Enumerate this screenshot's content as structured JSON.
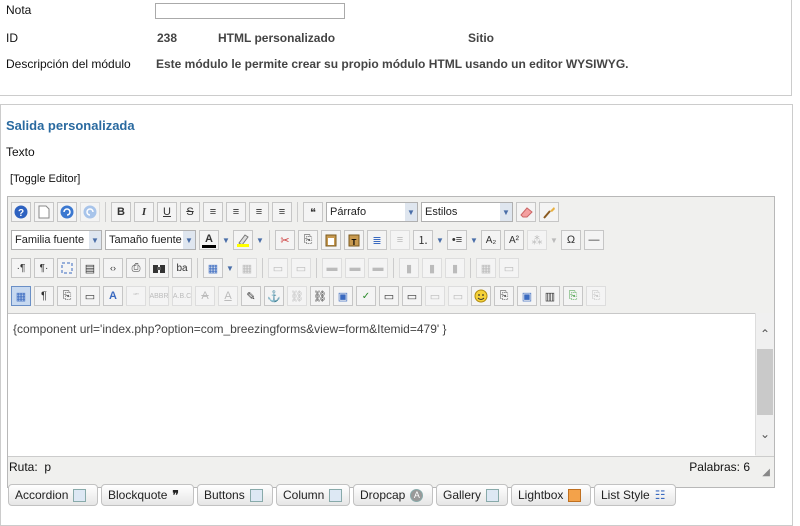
{
  "details": {
    "note_label": "Nota",
    "id_label": "ID",
    "id_value": "238",
    "type_value": "HTML personalizado",
    "site_value": "Sitio",
    "desc_label": "Descripción del módulo",
    "desc_value": "Este módulo le permite crear su propio módulo HTML usando un editor WYSIWYG."
  },
  "output": {
    "legend": "Salida personalizada",
    "text_label": "Texto",
    "toggle_label": "[Toggle Editor]"
  },
  "toolbar": {
    "format_select": "Párrafo",
    "styles_select": "Estilos",
    "font_family_select": "Familia fuente",
    "font_size_select": "Tamaño fuente"
  },
  "editor": {
    "content": "{component url='index.php?option=com_breezingforms&view=form&Itemid=479' }",
    "path_label": "Ruta:",
    "path_value": "p",
    "word_count": "Palabras: 6"
  },
  "plugins": [
    {
      "label": "Accordion",
      "icon": "accordion-icon"
    },
    {
      "label": "Blockquote",
      "icon": "quote-icon"
    },
    {
      "label": "Buttons",
      "icon": "button-icon"
    },
    {
      "label": "Column",
      "icon": "columns-icon"
    },
    {
      "label": "Dropcap",
      "icon": "dropcap-icon"
    },
    {
      "label": "Gallery",
      "icon": "gallery-icon"
    },
    {
      "label": "Lightbox",
      "icon": "lightbox-icon"
    },
    {
      "label": "List Style",
      "icon": "list-icon"
    }
  ],
  "colors": {
    "legend_blue": "#2a6aa0",
    "toolbar_bg": "#f0f0ee",
    "selected_button": "#c7d9f0"
  }
}
